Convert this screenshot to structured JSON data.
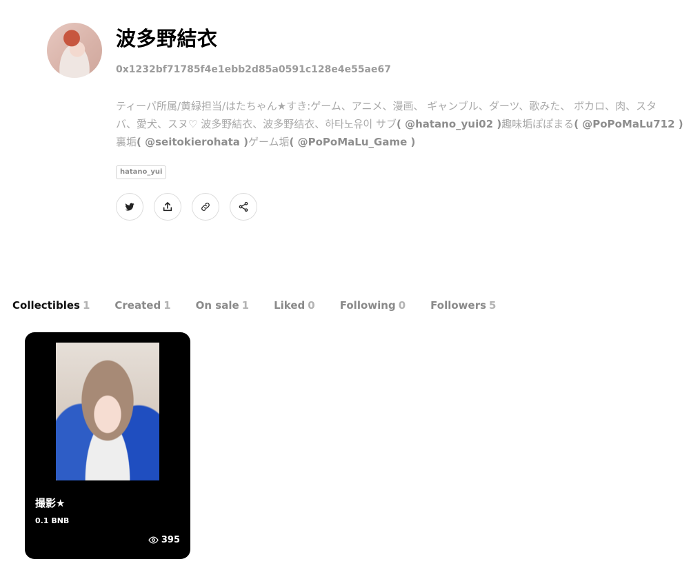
{
  "profile": {
    "name": "波多野結衣",
    "address": "0x1232bf71785f4e1ebb2d85a0591c128e4e55ae67",
    "bio": {
      "line1": "ティーパ所属/黄緑担当/はたちゃん★すき:ゲーム、アニメ、漫画、 ギャンブル、ダーツ、歌みた、 ボカロ、肉、スタ",
      "line2_text": "バ、愛犬、スヌ♡ 波多野結衣、波多野结衣、하타노유이 サブ",
      "handle1": "( @hatano_yui02 )",
      "line2_mid": "趣味垢ぽぽまる",
      "handle2": "( @PoPoMaLu712 )",
      "line3_text": "裏垢",
      "handle3": "( @seitokierohata )",
      "line3_mid": "ゲーム垢",
      "handle4": "( @PoPoMaLu_Game )"
    },
    "tag": "hatano_yui"
  },
  "actions": {
    "twitter_icon": "twitter-icon",
    "upload_icon": "upload-icon",
    "link_icon": "link-icon",
    "share_icon": "share-icon"
  },
  "tabs": [
    {
      "label": "Collectibles",
      "count": "1"
    },
    {
      "label": "Created",
      "count": "1"
    },
    {
      "label": "On sale",
      "count": "1"
    },
    {
      "label": "Liked",
      "count": "0"
    },
    {
      "label": "Following",
      "count": "0"
    },
    {
      "label": "Followers",
      "count": "5"
    }
  ],
  "items": [
    {
      "title": "撮影★",
      "price": "0.1 BNB",
      "views": "395"
    }
  ],
  "colors": {
    "accent": "#000000",
    "muted": "#a8a8a8",
    "card_bg": "#000000"
  }
}
